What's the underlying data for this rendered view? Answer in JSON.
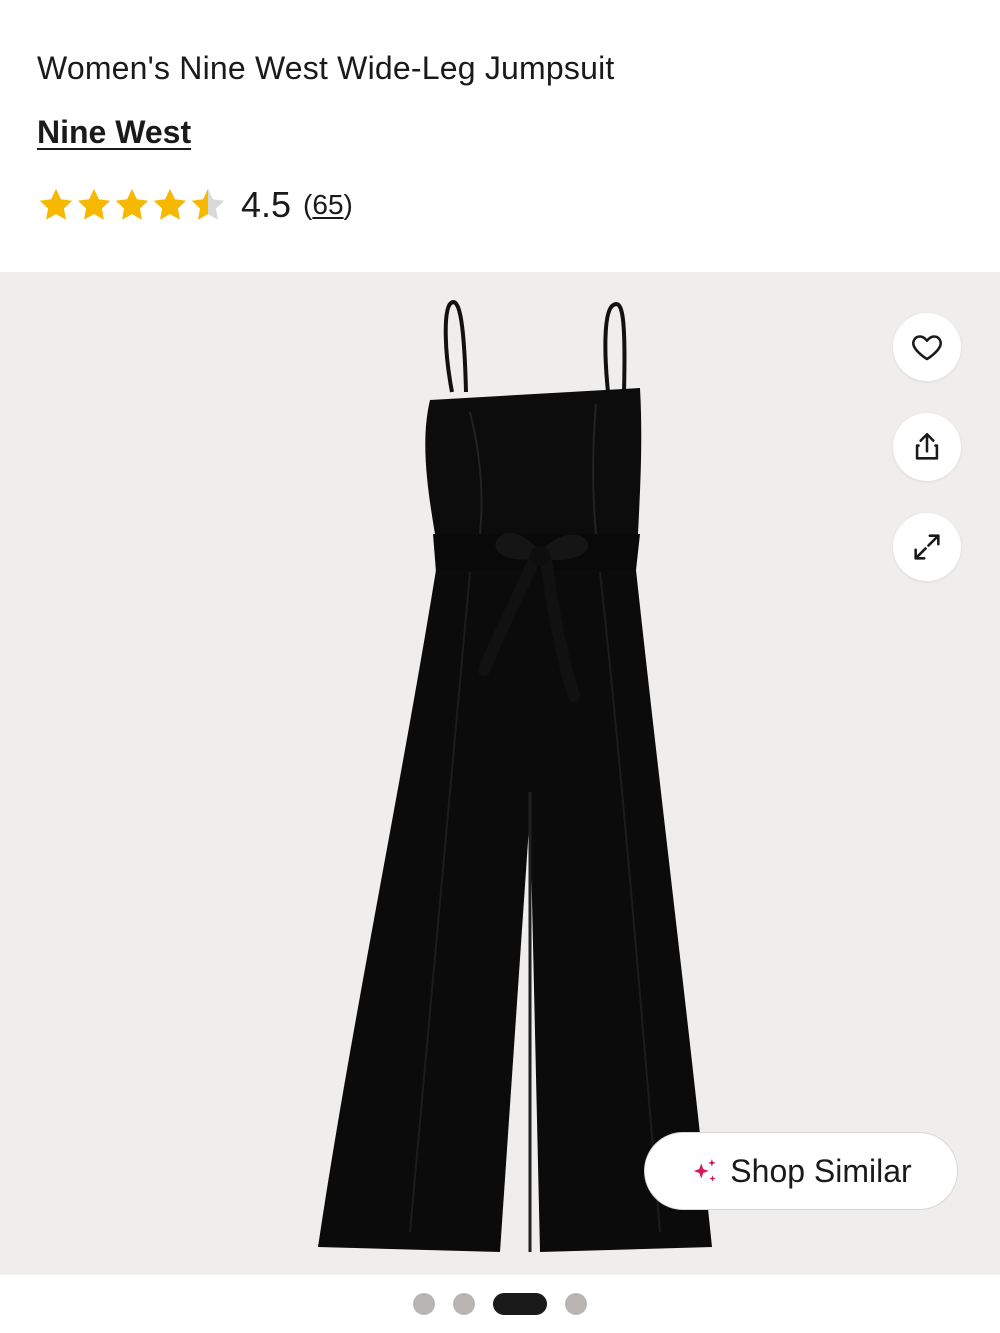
{
  "product": {
    "title": "Women's Nine West Wide-Leg Jumpsuit",
    "brand": "Nine West",
    "rating": {
      "value": "4.5",
      "count_open": "(",
      "count": "65",
      "count_close": ")",
      "stars_filled": 4.5,
      "stars_total": 5,
      "star_color": "#f6b800",
      "star_empty_color": "#d9d9d9"
    }
  },
  "gallery": {
    "background": "#efeeec",
    "image_icon": "black-jumpsuit-image",
    "actions": {
      "favorite_icon": "heart-icon",
      "share_icon": "share-icon",
      "expand_icon": "expand-icon"
    },
    "shop_similar": {
      "label": "Shop Similar",
      "icon": "sparkle-icon",
      "icon_color": "#d7195c"
    },
    "pagination": {
      "total": 4,
      "active_index": 2
    }
  }
}
